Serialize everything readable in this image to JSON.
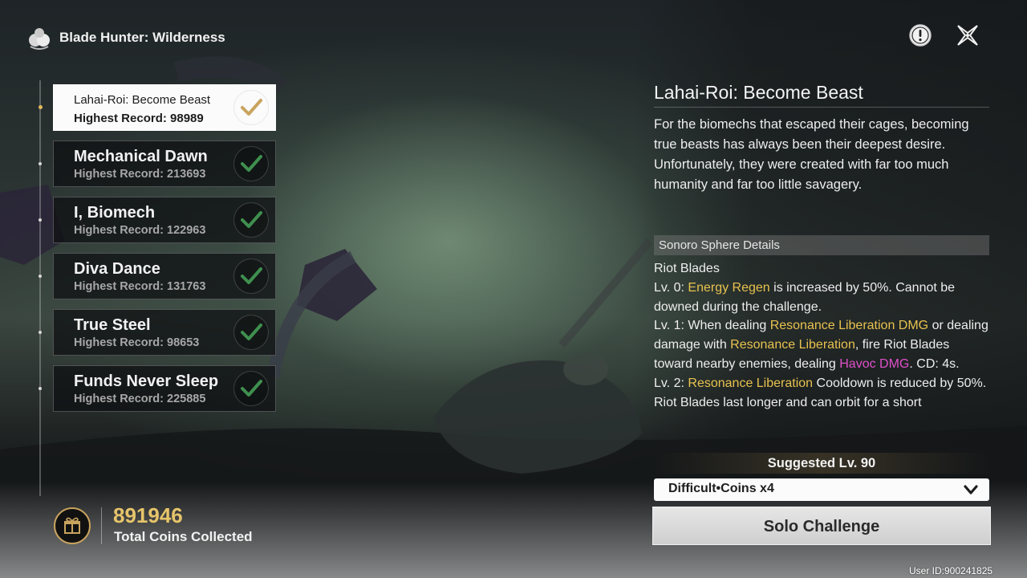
{
  "header": {
    "title": "Blade Hunter: Wilderness"
  },
  "challenges": [
    {
      "name": "Lahai-Roi: Become Beast",
      "record": "Highest Record: 98989",
      "selected": true
    },
    {
      "name": "Mechanical Dawn",
      "record": "Highest Record: 213693"
    },
    {
      "name": "I, Biomech",
      "record": "Highest Record: 122963"
    },
    {
      "name": "Diva Dance",
      "record": "Highest Record: 131763"
    },
    {
      "name": "True Steel",
      "record": "Highest Record: 98653"
    },
    {
      "name": "Funds Never Sleep",
      "record": "Highest Record: 225885"
    }
  ],
  "coins": {
    "value": "891946",
    "label": "Total Coins Collected"
  },
  "detail": {
    "title": "Lahai-Roi: Become Beast",
    "description": "For the biomechs that escaped their cages, becoming true beasts has always been their deepest desire. Unfortunately, they were created with far too much humanity and far too little savagery.",
    "section_title": "Sonoro Sphere Details",
    "effect_name": "Riot Blades",
    "lv0": {
      "prefix": "Lv. 0: ",
      "term": "Energy Regen",
      "suffix": " is increased by 50%. Cannot be downed during the challenge."
    },
    "lv1": {
      "prefix": "Lv. 1: When dealing ",
      "term1": "Resonance Liberation DMG",
      "mid1": " or dealing damage with ",
      "term2": "Resonance Liberation",
      "mid2": ", fire Riot Blades toward nearby enemies, dealing ",
      "term3": "Havoc DMG",
      "suffix": ". CD: 4s."
    },
    "lv2": {
      "prefix": "Lv. 2: ",
      "term": "Resonance Liberation",
      "suffix": " Cooldown is reduced by 50%. Riot Blades last longer and can orbit for a short"
    }
  },
  "suggested_level": "Suggested Lv. 90",
  "difficulty": {
    "selected": "Difficult•Coins x4"
  },
  "solo_button": "Solo Challenge",
  "user_id": "User ID:900241825",
  "colors": {
    "highlight": "#e8c24f",
    "havoc": "#e04fcb",
    "gold": "#e6c46a",
    "check_green": "#3f8f4e",
    "check_gold": "#c9a45e"
  },
  "icons": {
    "logo": "blade-hunter-logo-icon",
    "info": "info-icon",
    "close": "close-icon",
    "check": "check-icon",
    "gift": "gift-icon",
    "chevron": "chevron-down-icon"
  }
}
